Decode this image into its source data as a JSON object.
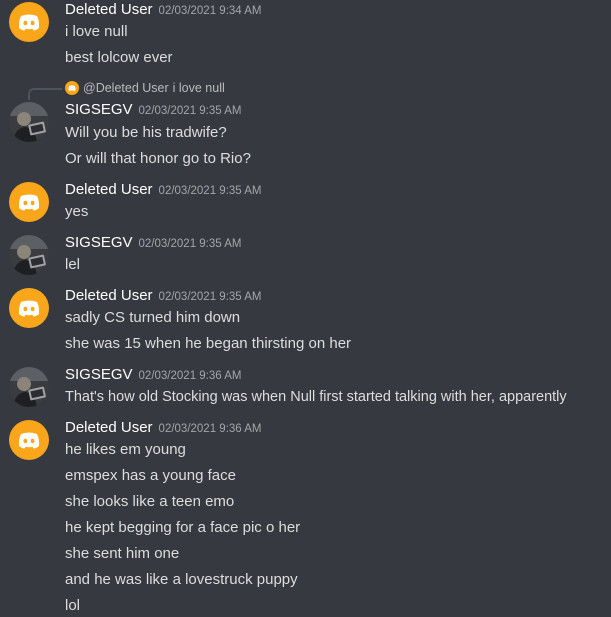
{
  "messages": [
    {
      "username": "Deleted User",
      "timestamp": "02/03/2021 9:34 AM",
      "avatar": "discord-default",
      "lines": [
        "i love null",
        "best lolcow ever"
      ]
    },
    {
      "reply": {
        "mention": "@Deleted User",
        "text": "i love null"
      },
      "username": "SIGSEGV",
      "timestamp": "02/03/2021 9:35 AM",
      "avatar": "user-photo",
      "lines": [
        "Will you be his tradwife?",
        "Or will that honor go to Rio?"
      ]
    },
    {
      "username": "Deleted User",
      "timestamp": "02/03/2021 9:35 AM",
      "avatar": "discord-default",
      "lines": [
        "yes"
      ]
    },
    {
      "username": "SIGSEGV",
      "timestamp": "02/03/2021 9:35 AM",
      "avatar": "user-photo",
      "lines": [
        "lel"
      ]
    },
    {
      "username": "Deleted User",
      "timestamp": "02/03/2021 9:35 AM",
      "avatar": "discord-default",
      "lines": [
        "sadly CS turned him down",
        "she was 15 when he began thirsting on her"
      ]
    },
    {
      "username": "SIGSEGV",
      "timestamp": "02/03/2021 9:36 AM",
      "avatar": "user-photo",
      "lines": [
        "That's how old Stocking was when Null first started talking with her, apparently"
      ]
    },
    {
      "username": "Deleted User",
      "timestamp": "02/03/2021 9:36 AM",
      "avatar": "discord-default",
      "lines": [
        "he likes em young",
        "emspex has a young face",
        "she looks like a teen emo",
        "he kept begging for a face pic o her",
        "she sent him one",
        "and he was like a lovestruck puppy",
        "lol"
      ]
    }
  ],
  "colors": {
    "background": "#36393f",
    "username": "#ffffff",
    "timestamp": "#a3a6aa",
    "text": "#dcddde",
    "discord_avatar": "#faa61a"
  }
}
